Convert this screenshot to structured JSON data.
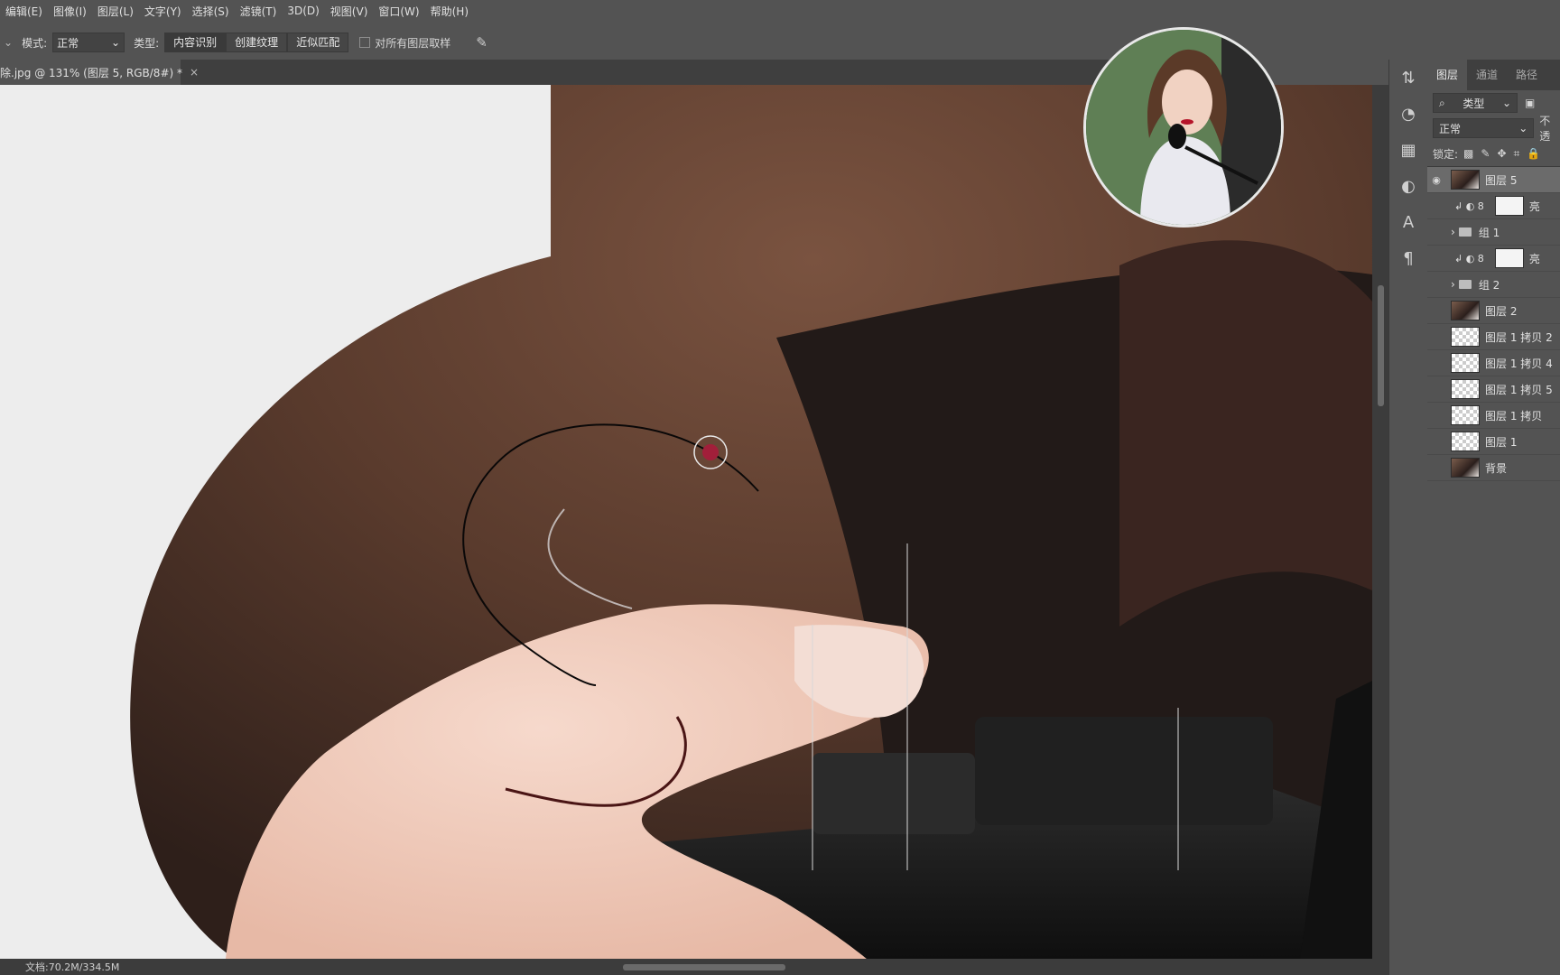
{
  "menubar": {
    "items": [
      "编辑(E)",
      "图像(I)",
      "图层(L)",
      "文字(Y)",
      "选择(S)",
      "滤镜(T)",
      "3D(D)",
      "视图(V)",
      "窗口(W)",
      "帮助(H)"
    ]
  },
  "options": {
    "mode_label": "模式:",
    "mode_value": "正常",
    "type_label": "类型:",
    "type_buttons": [
      "内容识别",
      "创建纹理",
      "近似匹配"
    ],
    "sample_all_label": "对所有图层取样"
  },
  "document": {
    "tab_title": "除.jpg @ 131% (图层 5, RGB/8#) *",
    "close": "×",
    "status": "文档:70.2M/334.5M"
  },
  "panel": {
    "tabs": [
      "图层",
      "通道",
      "路径"
    ],
    "filter_value": "类型",
    "blend_value": "正常",
    "opacity_label": "不透",
    "lock_label": "锁定:",
    "layers": [
      {
        "name": "图层 5",
        "kind": "photo",
        "visible": true,
        "selected": true
      },
      {
        "name": "亮",
        "kind": "adjust",
        "visible": false,
        "selected": false
      },
      {
        "name": "组 1",
        "kind": "group",
        "visible": false,
        "selected": false
      },
      {
        "name": "亮",
        "kind": "adjust",
        "visible": false,
        "selected": false
      },
      {
        "name": "组 2",
        "kind": "group",
        "visible": false,
        "selected": false
      },
      {
        "name": "图层 2",
        "kind": "photo",
        "visible": false,
        "selected": false
      },
      {
        "name": "图层 1 拷贝 2",
        "kind": "checker",
        "visible": false,
        "selected": false
      },
      {
        "name": "图层 1 拷贝 4",
        "kind": "checker",
        "visible": false,
        "selected": false
      },
      {
        "name": "图层 1 拷贝 5",
        "kind": "checker",
        "visible": false,
        "selected": false
      },
      {
        "name": "图层 1 拷贝",
        "kind": "checker",
        "visible": false,
        "selected": false
      },
      {
        "name": "图层 1",
        "kind": "checker",
        "visible": false,
        "selected": false
      },
      {
        "name": "背景",
        "kind": "photo",
        "visible": false,
        "selected": false
      }
    ]
  },
  "colors": {
    "ui_bg": "#535353",
    "canvas_bg": "#ededed",
    "hat": "#5a3a2b",
    "shadow": "#1d1818",
    "skin": "#f1cdbd",
    "camera": "#1b1b1b"
  }
}
